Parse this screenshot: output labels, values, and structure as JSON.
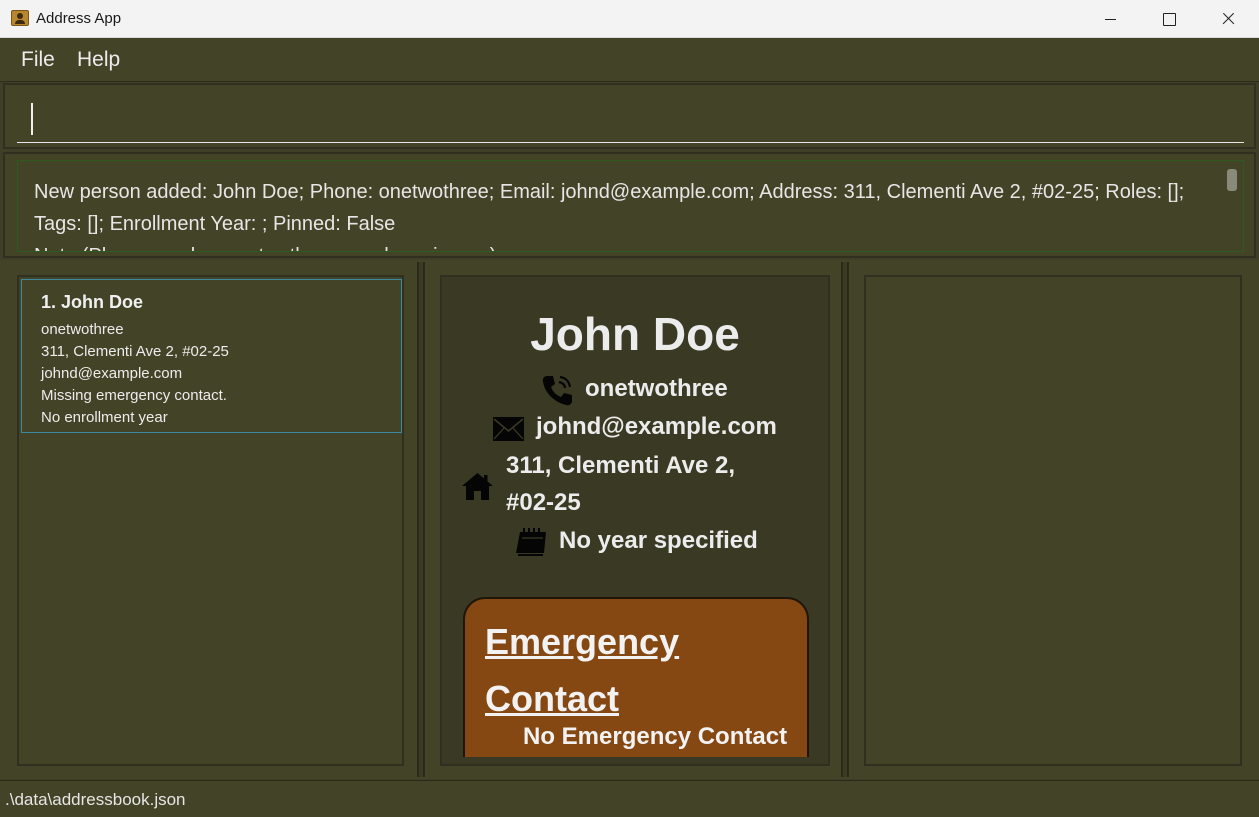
{
  "window": {
    "title": "Address App"
  },
  "menu": {
    "items": [
      {
        "label": "File"
      },
      {
        "label": "Help"
      }
    ]
  },
  "command": {
    "value": ""
  },
  "result": {
    "lines": [
      "New person added: John Doe; Phone: onetwothree; Email: johnd@example.com; Address: 311, Clementi Ave 2, #02-25; Roles: [];",
      "Tags: []; Enrollment Year: ; Pinned: False",
      "Note (Phone number onetwothree may have issues):"
    ]
  },
  "person_list": {
    "cards": [
      {
        "index_name": "1. John Doe",
        "phone": "onetwothree",
        "address": "311, Clementi Ave 2, #02-25",
        "email": "johnd@example.com",
        "emergency": "Missing emergency contact.",
        "enrollment": "No enrollment year"
      }
    ]
  },
  "detail": {
    "name": "John Doe",
    "phone": "onetwothree",
    "email": "johnd@example.com",
    "address_line1": "311, Clementi Ave 2,",
    "address_line2": "#02-25",
    "year": "No year specified",
    "emergency_title_line1": "Emergency",
    "emergency_title_line2": "Contact",
    "emergency_value": "No Emergency Contact"
  },
  "status": {
    "path": ".\\data\\addressbook.json"
  },
  "colors": {
    "background": "#434328",
    "detail_background": "#3a3a24",
    "emergency_card": "#854812",
    "card_border": "#3d8aa0"
  },
  "icons": [
    "phone-icon",
    "envelope-icon",
    "home-icon",
    "calendar-icon"
  ]
}
